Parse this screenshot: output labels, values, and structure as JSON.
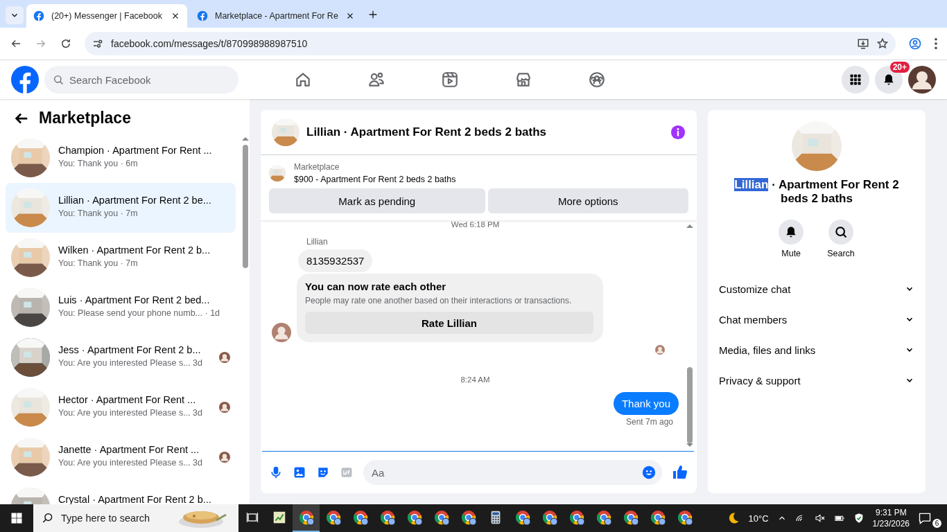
{
  "browser": {
    "tabs": [
      {
        "title": "(20+) Messenger | Facebook",
        "selected": true
      },
      {
        "title": "Marketplace - Apartment For Re",
        "selected": false
      }
    ],
    "url": "facebook.com/messages/t/870998988987510"
  },
  "header": {
    "search": {
      "placeholder": "Search Facebook"
    },
    "notification_badge": "20+"
  },
  "sidebar": {
    "title": "Marketplace",
    "conversations": [
      {
        "name": "Champion · Apartment For Rent ...",
        "preview": "You: Thank you · 6m",
        "selected": false,
        "seen_avatar": false
      },
      {
        "name": "Lillian · Apartment For Rent 2 be...",
        "preview": "You: Thank you · 7m",
        "selected": true,
        "seen_avatar": false
      },
      {
        "name": "Wilken · Apartment For Rent 2 b...",
        "preview": "You: Thank you · 7m",
        "selected": false,
        "seen_avatar": false
      },
      {
        "name": "Luis · Apartment For Rent 2 bed...",
        "preview": "You: Please send your phone numb... · 1d",
        "selected": false,
        "seen_avatar": false
      },
      {
        "name": "Jess · Apartment For Rent 2 b...",
        "preview": "You: Are you interested Please s...  3d",
        "selected": false,
        "seen_avatar": true
      },
      {
        "name": "Hector · Apartment For Rent ...",
        "preview": "You: Are you interested Please s...  3d",
        "selected": false,
        "seen_avatar": true
      },
      {
        "name": "Janette · Apartment For Rent ...",
        "preview": "You: Are you interested Please s...  3d",
        "selected": false,
        "seen_avatar": true
      },
      {
        "name": "Crystal · Apartment For Rent 2 b...",
        "selected": false,
        "seen_avatar": false
      }
    ]
  },
  "chat": {
    "title": "Lillian · Apartment For Rent 2 beds 2 baths",
    "listing": {
      "label": "Marketplace",
      "title": "$900 - Apartment For Rent 2 beds 2 baths"
    },
    "actions": [
      "Mark as pending",
      "More options"
    ],
    "messages": [
      {
        "kind": "time",
        "text": "Wed 6:18 PM"
      },
      {
        "kind": "sender",
        "text": "Lillian"
      },
      {
        "kind": "incoming",
        "text": "8135932537"
      },
      {
        "kind": "card",
        "title": "You can now rate each other",
        "body": "People may rate one another based on their interactions or transactions.",
        "button": "Rate Lillian"
      },
      {
        "kind": "seen"
      },
      {
        "kind": "time",
        "text": "8:24 AM"
      },
      {
        "kind": "outgoing",
        "text": "Thank you",
        "status": "Sent 7m ago"
      }
    ],
    "composer": {
      "placeholder": "Aa"
    }
  },
  "details": {
    "title": [
      {
        "text": "Lillian",
        "selected": true
      },
      {
        "text": " · Apartment For Rent 2 beds 2 baths",
        "selected": false
      }
    ],
    "actions": [
      {
        "kind": "mute",
        "label": "Mute"
      },
      {
        "kind": "search",
        "label": "Search"
      }
    ],
    "sections": [
      {
        "label": "Customize chat",
        "expanded": false
      },
      {
        "label": "Chat members",
        "expanded": false
      },
      {
        "label": "Media, files and links",
        "expanded": false
      },
      {
        "label": "Privacy & support",
        "expanded": false
      }
    ]
  },
  "taskbar": {
    "search": {
      "placeholder": "Type here to search"
    },
    "apps": [
      {
        "kind": "taskview",
        "selected": false
      },
      {
        "kind": "sheet",
        "selected": false
      },
      {
        "kind": "browser",
        "selected": true
      },
      {
        "kind": "browser",
        "selected": false
      },
      {
        "kind": "browser",
        "selected": false
      },
      {
        "kind": "browser",
        "selected": false
      },
      {
        "kind": "browser",
        "selected": false
      },
      {
        "kind": "browser",
        "selected": false
      },
      {
        "kind": "browser",
        "selected": false
      },
      {
        "kind": "calculator",
        "selected": false
      },
      {
        "kind": "browser",
        "selected": false
      },
      {
        "kind": "browser",
        "selected": false
      },
      {
        "kind": "browser",
        "selected": false
      },
      {
        "kind": "browser",
        "selected": false
      },
      {
        "kind": "browser",
        "selected": false
      },
      {
        "kind": "browser",
        "selected": false
      },
      {
        "kind": "browser",
        "selected": false
      }
    ],
    "weather": "10°C",
    "time": "9:31 PM",
    "date": "1/23/2026",
    "notifications": "6"
  }
}
